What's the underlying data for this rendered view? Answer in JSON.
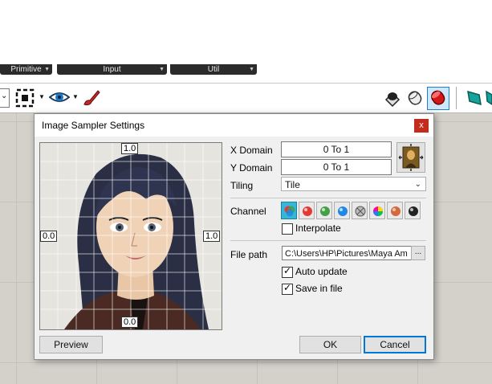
{
  "tabs": [
    "Primitive",
    "Input",
    "Util"
  ],
  "toolbar": {
    "icons": [
      "dropdown",
      "select-frame-icon",
      "eye-icon",
      "paint-brush-icon",
      "preview-shaded-icon",
      "preview-wire-icon",
      "preview-selected-icon",
      "preview-teal-icon"
    ]
  },
  "dialog": {
    "title": "Image Sampler Settings",
    "close_label": "x",
    "preview": {
      "top_label": "1.0",
      "left_label": "0.0",
      "right_label": "1.0",
      "bottom_label": "0.0"
    },
    "x_domain_label": "X Domain",
    "x_domain_value": "0 To 1",
    "y_domain_label": "Y Domain",
    "y_domain_value": "0 To 1",
    "tiling_label": "Tiling",
    "tiling_value": "Tile",
    "channel_label": "Channel",
    "channels": [
      "colour",
      "red",
      "green",
      "blue",
      "alpha",
      "hue",
      "saturation",
      "brightness"
    ],
    "interpolate_label": "Interpolate",
    "interpolate_checked": false,
    "file_path_label": "File path",
    "file_path_value": "C:\\Users\\HP\\Pictures\\Maya Am",
    "browse_label": "...",
    "auto_update_label": "Auto update",
    "auto_update_checked": true,
    "save_in_file_label": "Save in file",
    "save_in_file_checked": true,
    "preview_button": "Preview",
    "ok_button": "OK",
    "cancel_button": "Cancel"
  }
}
